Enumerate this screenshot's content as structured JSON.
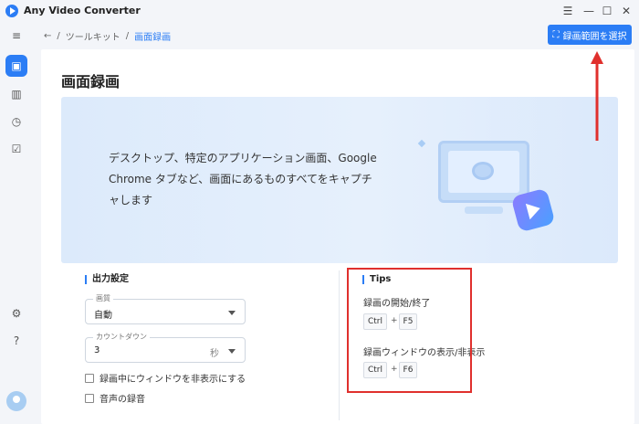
{
  "app": {
    "title": "Any Video Converter"
  },
  "window": {
    "menu_icon": "menu-icon",
    "minimize_icon": "minimize-icon",
    "maximize_icon": "maximize-icon",
    "close_icon": "close-icon"
  },
  "breadcrumb": {
    "root": "ツールキット",
    "separator": "/",
    "current": "画面録画"
  },
  "header": {
    "select_area_button": "録画範囲を選択"
  },
  "page": {
    "title": "画面録画"
  },
  "banner": {
    "description": "デスクトップ、特定のアプリケーション画面、Google Chrome タブなど、画面にあるものすべてをキャプチャします"
  },
  "output": {
    "title": "出力設定",
    "quality": {
      "label": "画質",
      "value": "自動"
    },
    "countdown": {
      "label": "カウントダウン",
      "value": "3",
      "unit": "秒"
    },
    "hide_window_label": "録画中にウィンドウを非表示にする",
    "record_audio_label": "音声の録音"
  },
  "tips": {
    "title": "Tips",
    "start_stop_label": "録画の開始/終了",
    "start_stop_keys": [
      "Ctrl",
      "+",
      "F5"
    ],
    "toggle_window_label": "録画ウィンドウの表示/非表示",
    "toggle_window_keys": [
      "Ctrl",
      "+",
      "F6"
    ]
  },
  "colors": {
    "accent": "#2b7df5",
    "annotation": "#e0302d"
  }
}
